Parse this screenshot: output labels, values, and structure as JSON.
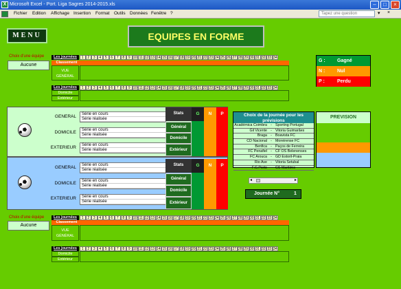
{
  "window": {
    "title": "Microsoft Excel - Port. Liga Sagres 2014-2015.xls",
    "icon": "excel-icon"
  },
  "menu": [
    "Fichier",
    "Edition",
    "Affichage",
    "Insertion",
    "Format",
    "Outils",
    "Données",
    "Fenêtre",
    "?"
  ],
  "help_placeholder": "Tapez une question",
  "menu_button": "MENU",
  "banner": "EQUIPES EN FORME",
  "top_block": {
    "choose_label": "Choix d'une équipe",
    "team_value": "Aucune",
    "journees_label": "Les journées",
    "classement_label": "Classement",
    "vue_general": "VUE GÉNÉRAL",
    "numbers": [
      "1",
      "2",
      "3",
      "4",
      "5",
      "6",
      "7",
      "8",
      "9",
      "10",
      "11",
      "12",
      "13",
      "14",
      "15",
      "16",
      "17",
      "18",
      "19",
      "20",
      "21",
      "22",
      "23",
      "24",
      "25",
      "26",
      "27",
      "28",
      "29",
      "30",
      "31",
      "32",
      "33",
      "34"
    ]
  },
  "row_block_1": {
    "journees_label": "Les journées",
    "domicile": "Domicile",
    "exterieur": "Extérieur"
  },
  "legend": {
    "gagne_key": "G :",
    "gagne": "Gagné",
    "nul_key": "N :",
    "nul": "Nul",
    "perdu_key": "P :",
    "perdu": "Perdu",
    "colors": {
      "gagne": "#009933",
      "nul": "#ff9900",
      "perdu": "#ff0000"
    }
  },
  "panel1": {
    "general": "GENERAL",
    "domicile": "DOMICILE",
    "exterieur": "EXTERIEUR",
    "serie_en_cours": "Série en cours",
    "serie_realisee": "Série réalisée",
    "stats": "Stats",
    "stat_general": "Général",
    "stat_domicile": "Domicile",
    "stat_exterieur": "Extérieur",
    "g": "G",
    "n": "N",
    "p": "P"
  },
  "panel2": {
    "general": "GENERAL",
    "domicile": "DOMICILE",
    "exterieur": "EXTERIEUR",
    "serie_en_cours": "Série en cours",
    "serie_realisee": "Série réalisée",
    "stats": "Stats",
    "stat_general": "Général",
    "stat_domicile": "Domicile",
    "stat_exterieur": "Extérieur",
    "g": "G",
    "n": "N",
    "p": "P"
  },
  "choix": {
    "title": "Choix de la journée pour les prévisions",
    "matches": [
      {
        "home": "Académica Coimbra",
        "sep": "-",
        "away": "Sporting Portugal"
      },
      {
        "home": "Gil Vicente",
        "sep": "-",
        "away": "Vitoria Guimarães"
      },
      {
        "home": "Braga",
        "sep": "-",
        "away": "Boavista FC"
      },
      {
        "home": "CD Nacional",
        "sep": "-",
        "away": "Moreirense FC"
      },
      {
        "home": "Benfica",
        "sep": "-",
        "away": "Paços de Ferreira"
      },
      {
        "home": "FC Penafiel",
        "sep": "-",
        "away": "CF OS Belenenses"
      },
      {
        "home": "FC Arouca",
        "sep": "-",
        "away": "GD Estoril-Praia"
      },
      {
        "home": "Rio Ave",
        "sep": "-",
        "away": "Vitoria Setubal"
      },
      {
        "home": "F.C.Porto",
        "sep": "-",
        "away": "CS Maritimo"
      }
    ]
  },
  "prevision": "PREVISION",
  "journee_label": "Journée N°",
  "journee_value": "1",
  "bottom_block": {
    "choose_label": "Choix d'une équipe",
    "team_value": "Aucune",
    "journees_label": "Les journées",
    "classement_label": "Classement",
    "vue_general": "VUE GÉNÉRAL"
  },
  "row_block_2": {
    "journees_label": "Les journées",
    "domicile": "Domicile",
    "exterieur": "Extérieur"
  }
}
